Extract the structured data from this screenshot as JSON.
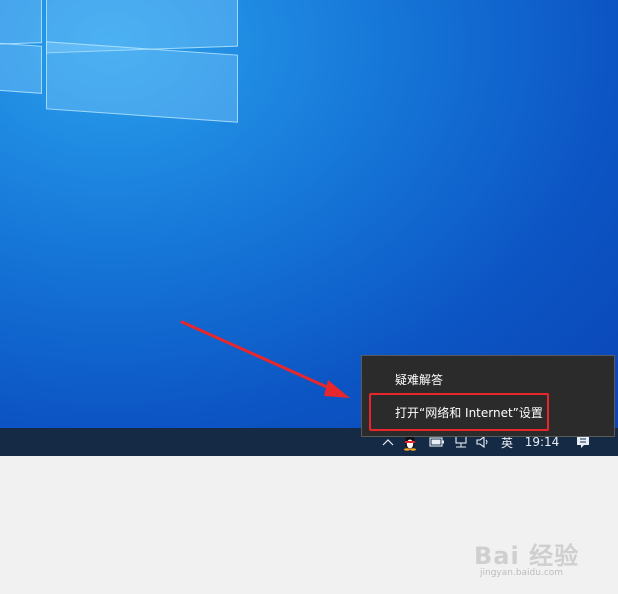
{
  "context_menu": {
    "items": [
      {
        "label": "疑难解答"
      },
      {
        "label": "打开“网络和 Internet”设置"
      }
    ]
  },
  "taskbar": {
    "language": "英",
    "clock": "19:14"
  },
  "tray_icons": [
    "chevron-up-icon",
    "qq-penguin-icon",
    "battery-icon",
    "network-icon",
    "volume-icon",
    "notification-icon"
  ],
  "watermark": {
    "text": "Bai 经验",
    "subtext": "jingyan.baidu.com"
  },
  "colors": {
    "desktop": "#0c55c4",
    "taskbar": "#142a45",
    "menu_bg": "#2b2b2b",
    "highlight": "#e8262c"
  }
}
